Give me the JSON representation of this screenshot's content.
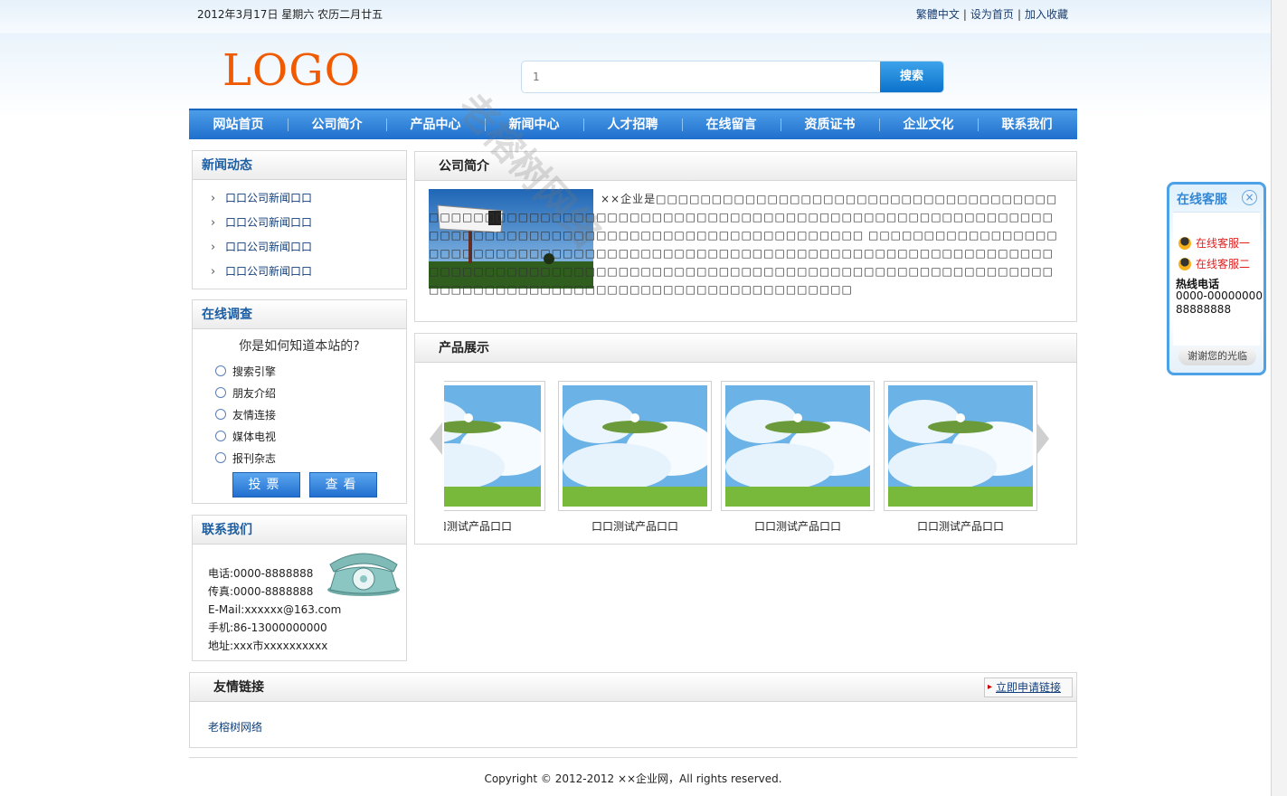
{
  "topbar": {
    "date": "2012年3月17日 星期六 农历二月廿五",
    "links": [
      "繁體中文",
      "设为首页",
      "加入收藏"
    ]
  },
  "header": {
    "logo": "LOGO",
    "search_placeholder": "1",
    "search_button": "搜索"
  },
  "nav": [
    "网站首页",
    "公司简介",
    "产品中心",
    "新闻中心",
    "人才招聘",
    "在线留言",
    "资质证书",
    "企业文化",
    "联系我们"
  ],
  "news": {
    "title": "新闻动态",
    "items": [
      "口口公司新闻口口",
      "口口公司新闻口口",
      "口口公司新闻口口",
      "口口公司新闻口口"
    ]
  },
  "survey": {
    "title": "在线调查",
    "question": "你是如何知道本站的?",
    "options": [
      "搜索引擎",
      "朋友介绍",
      "友情连接",
      "媒体电视",
      "报刊杂志"
    ],
    "vote": "投票",
    "view": "查看"
  },
  "contact": {
    "title": "联系我们",
    "lines": [
      "电话:0000-8888888",
      "传真:0000-8888888",
      "E-Mail:xxxxxx@163.com",
      "手机:86-13000000000",
      "地址:xxx市xxxxxxxxxx"
    ]
  },
  "intro": {
    "title": "公司简介",
    "text": "××企业是□□□□□□□□□□□□□□□□□□□□□□□□□□□□□□□□□□□□□□□□□□□□□□□□□□□□□□□□□□□□□□□□□□□□□□□□□□□□□□□□□□□□□□□□□□□□□□□□□□□□□□□□□□□□□□□□□□□□□□□□□□□□□□□□□□□ □□□□□□□□□□□□□□□□□□□□□□□□□□□□□□□□□□□□□□□□□□□□□□□□□□□□□□□□□□□□□□□□□□□□□□□□□□□□□□□□□□□□□□□□□□□□□□□□□□□□□□□□□□□□□□□□□□□□□□□□□□□□□□□□□□□□□□□□□□□□□□□□□□□□□□□□□□□□□□□□□□□□□□□"
  },
  "products": {
    "title": "产品展示",
    "items": [
      "口口测试产品口口",
      "口口测试产品口口",
      "口口测试产品口口",
      "口口测试产品口口"
    ]
  },
  "friend_links": {
    "title": "友情链接",
    "apply": "立即申请链接",
    "items": [
      "老榕树网络"
    ]
  },
  "footer": {
    "copyright": "Copyright © 2012-2012 ××企业网，All rights reserved."
  },
  "service": {
    "title": "在线客服",
    "agents": [
      "在线客服一",
      "在线客服二"
    ],
    "hotline_label": "热线电话",
    "hotline_number": "0000-00000000",
    "hotline_number2": "88888888",
    "thanks": "谢谢您的光临"
  },
  "watermark": "老榕树网络"
}
